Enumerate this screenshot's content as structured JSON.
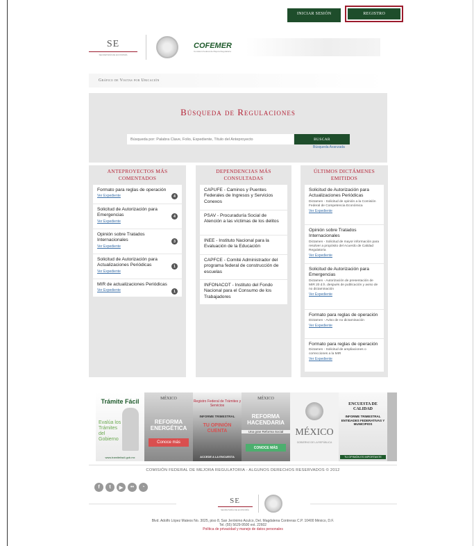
{
  "top_nav": {
    "login_label": "Iniciar Sesión",
    "register_label": "Registro"
  },
  "header": {
    "se_text": "SE",
    "se_subtitle": "SECRETARÍA DE ECONOMÍA",
    "cofemer_text": "COFEMER",
    "cofemer_subtitle": "Comisión Federal de Mejora Regulatoria"
  },
  "strip": {
    "label": "Gráfico de Visitas por Ubicación"
  },
  "search": {
    "title": "Búsqueda de Regulaciones",
    "placeholder": "Búsqueda por: Palabra Clave, Folio, Expediente, Título del Anteproyecto",
    "button_label": "Buscar",
    "advanced_label": "Búsqueda Avanzada"
  },
  "columns": {
    "anteproyectos": {
      "title": "Anteproyectos más comentados",
      "items": [
        {
          "title": "Formato para reglas de operación",
          "link": "Ver Expediente",
          "count": "4"
        },
        {
          "title": "Solicitud de Autorización para Emergencias",
          "link": "Ver Expediente",
          "count": "4"
        },
        {
          "title": "Opinión sobre Tratados Internacionales",
          "link": "Ver Expediente",
          "count": "3"
        },
        {
          "title": "Solicitud de Autorización para Actualizaciones Periódicas",
          "link": "Ver Expediente",
          "count": "1"
        },
        {
          "title": "MIR de actualizaciones Periódicas",
          "link": "Ver Expediente",
          "count": "1"
        }
      ]
    },
    "dependencias": {
      "title": "Dependencias más consultadas",
      "items": [
        {
          "title": "CAPUFE - Caminos y Puentes Federales de Ingresos y Servicios Conexos"
        },
        {
          "title": "PSAV - Procuraduría Social de Atención a las víctimas de los delitos"
        },
        {
          "title": "INEE - Instituto Nacional para la Evaluación de la Educación"
        },
        {
          "title": "CAPFCE - Comité Administrador del programa federal de construcción de escuelas"
        },
        {
          "title": "INFONACOT - Instituto del Fondo Nacional para el Consumo de los Trabajadores"
        }
      ]
    },
    "dictamenes": {
      "title": "Últimos dictámenes emitidos",
      "items": [
        {
          "title": "Solicitud de Autorización para Actualizaciones Periódicas",
          "desc": "Dictamen - Solicitud de opinión a la Comisión Federal de Competencia Económica",
          "link": "Ver Expediente"
        },
        {
          "title": "Opinión sobre Tratados Internacionales",
          "desc": "Dictamen - Solicitud de mayor información para resolver a propósito del Acuerdo de Calidad Regulatoria",
          "link": "Ver Expediente"
        },
        {
          "title": "Solicitud de Autorización para Emergencias",
          "desc": "Dictamen - Autorización de presentación de MIR 20 d.h. después de publicación y aviso de no dictaminación",
          "link": "Ver Expediente"
        },
        {
          "title": "Formato para reglas de operación",
          "desc": "Dictamen - Aviso de no dictaminación",
          "link": "Ver Expediente"
        },
        {
          "title": "Formato para reglas de operación",
          "desc": "Dictamen - Solicitud de ampliaciones o correcciones a la MIR",
          "link": "Ver Expediente"
        }
      ]
    }
  },
  "banners": {
    "tramite": {
      "title": "Trámite Fácil",
      "lines": "Evalúa los Trámites del Gobierno",
      "url": "www.tramitefacil.gob.mx"
    },
    "reforma_energetica": {
      "brand": "MÉXICO",
      "title": "REFORMA ENERGÉTICA",
      "cta": "Conoce más"
    },
    "informe": {
      "registro": "Registro Federal de Trámites y Servicios",
      "informe": "INFORME TRIMESTRAL",
      "opinion": "TU OPINIÓN CUENTA",
      "acceder": "ACCEDE A LA ENCUESTA"
    },
    "reforma_hacendaria": {
      "brand": "MÉXICO",
      "title": "REFORMA HACENDARIA",
      "subtitle": "Una gran Reforma Social",
      "cta": "CONOCE MÁS"
    },
    "mexico": {
      "title": "MÉXICO",
      "subtitle": "GOBIERNO DE LA REPÚBLICA"
    },
    "encuesta": {
      "title": "ENCUESTA DE CALIDAD",
      "subtitle": "INFORME TRIMESTRAL ENTIDADES FEDERATIVAS Y MUNICIPIOS",
      "footer": "TU OPINIÓN ES IMPORTANTE"
    }
  },
  "footer": {
    "copyright": "Comisión Federal de Mejora Regulatoria - Algunos derechos reservados © 2012",
    "social": [
      "facebook-icon",
      "twitter-icon",
      "youtube-icon",
      "flickr-icon",
      "rss-icon"
    ],
    "se_text": "SE",
    "se_subtitle": "SECRETARÍA DE ECONOMÍA",
    "address_line1": "Blvd. Adolfo López Mateos No. 3025, piso 8, San Jerónimo Aculco, Del. Magdalena Contreras C.P. 10400 México, D.F.",
    "address_line2": "Tel. (55) 5629-9500 ext. 22602",
    "privacy": "Política de privacidad y manejo de datos personales"
  },
  "colors": {
    "accent_green": "#1e4d2b",
    "accent_red": "#b42236",
    "link_blue": "#3a6fa8",
    "panel_gray": "#e6e6e6"
  }
}
